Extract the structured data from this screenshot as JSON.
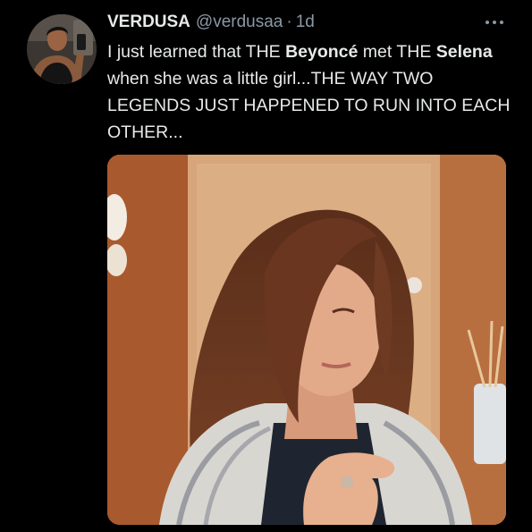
{
  "tweet": {
    "display_name": "VERDUSA",
    "handle": "@verdusaa",
    "separator": "·",
    "time": "1d",
    "text": {
      "part1": "I just learned that THE ",
      "bold1": "Beyoncé",
      "part2": " met THE ",
      "bold2": "Selena",
      "part3": " when she was a little girl...THE WAY TWO LEGENDS JUST HAPPENED TO RUN INTO EACH OTHER..."
    }
  },
  "icons": {
    "more": "more-horizontal-icon"
  },
  "colors": {
    "background": "#000000",
    "text_primary": "#e7e9ea",
    "text_secondary": "#8b98a5"
  }
}
